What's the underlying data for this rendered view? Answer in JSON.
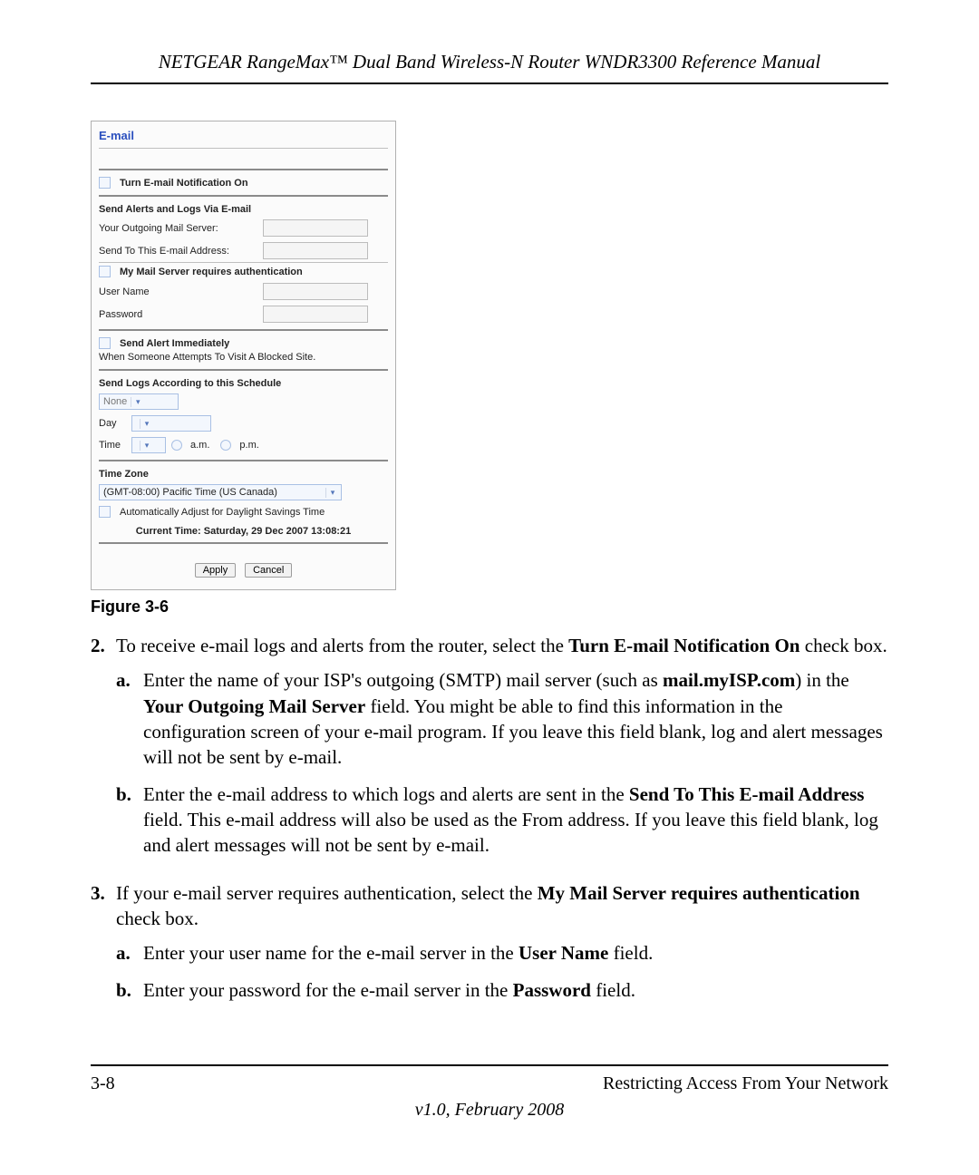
{
  "header": "NETGEAR RangeMax™ Dual Band Wireless-N Router WNDR3300 Reference Manual",
  "panel": {
    "title": "E-mail",
    "notify_label": "Turn E-mail Notification On",
    "section1": "Send Alerts and Logs Via E-mail",
    "smtp_label": "Your Outgoing Mail Server:",
    "sendto_label": "Send To This E-mail Address:",
    "auth_label": "My Mail Server requires authentication",
    "user_label": "User Name",
    "pass_label": "Password",
    "alert_label": "Send Alert Immediately",
    "alert_sub": "When Someone Attempts To Visit A Blocked Site.",
    "sched_header": "Send Logs According to this Schedule",
    "sched_sel": "None",
    "day_label": "Day",
    "time_label": "Time",
    "am": "a.m.",
    "pm": "p.m.",
    "tz_header": "Time Zone",
    "tz_value": "(GMT-08:00) Pacific Time (US Canada)",
    "dst_label": "Automatically Adjust for Daylight Savings Time",
    "current_time": "Current Time:  Saturday, 29 Dec 2007 13:08:21",
    "apply": "Apply",
    "cancel": "Cancel"
  },
  "figure_caption": "Figure 3-6",
  "steps": {
    "s2": {
      "num": "2.",
      "pre": "To receive e-mail logs and alerts from the router, select the ",
      "bold": "Turn E-mail Notification On",
      "post": " check box.",
      "a": {
        "num": "a.",
        "t1": "Enter the name of your ISP's outgoing (SMTP) mail server (such as ",
        "b1": "mail.myISP.com",
        "t2": ") in the ",
        "b2": "Your Outgoing Mail Server",
        "t3": " field. You might be able to find this information in the configuration screen of your e-mail program. If you leave this field blank, log and alert messages will not be sent by e-mail."
      },
      "b": {
        "num": "b.",
        "t1": "Enter the e-mail address to which logs and alerts are sent in the ",
        "b1": "Send To This E-mail Address",
        "t2": " field. This e-mail address will also be used as the From address. If you leave this field blank, log and alert messages will not be sent by e-mail."
      }
    },
    "s3": {
      "num": "3.",
      "t1": "If your e-mail server requires authentication, select the ",
      "b1": "My Mail Server requires authentication",
      "t2": " check box.",
      "a": {
        "num": "a.",
        "t1": "Enter your user name for the e-mail server in the ",
        "b1": "User Name",
        "t2": " field."
      },
      "b": {
        "num": "b.",
        "t1": "Enter your password for the e-mail server in the ",
        "b1": "Password",
        "t2": " field."
      }
    }
  },
  "footer": {
    "page": "3-8",
    "section": "Restricting Access From Your Network",
    "version": "v1.0, February 2008"
  }
}
